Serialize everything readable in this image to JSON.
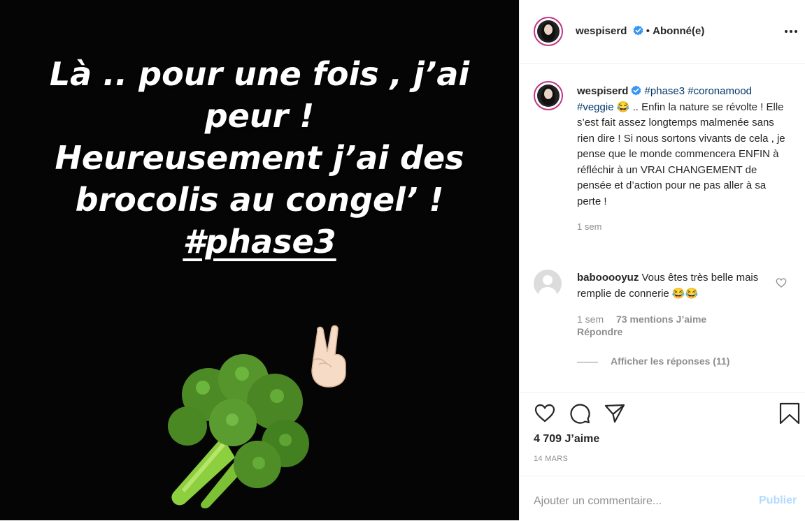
{
  "media": {
    "story_lines": [
      "Là .. pour une fois , j’ai",
      "peur !",
      "Heureusement j’ai des",
      "brocolis au congel’ !"
    ],
    "story_hashtag": "#phase3",
    "emojis": [
      "broccoli-icon",
      "victory-hand-icon"
    ]
  },
  "header": {
    "username": "wespiserd",
    "verified": true,
    "separator": "•",
    "follow_status": "Abonné(e)"
  },
  "caption": {
    "username": "wespiserd",
    "hashtags": [
      "#phase3",
      "#coronamood",
      "#veggie"
    ],
    "emoji": "😂",
    "text": ".. Enfin la nature se révolte ! Elle s’est fait assez longtemps malmenée sans rien dire ! Si nous sortons vivants de cela , je pense que le monde commencera ENFIN à réfléchir à un VRAI CHANGEMENT de pensée et d’action pour ne pas aller à sa perte !",
    "time": "1 sem"
  },
  "comment": {
    "username": "babooooyuz",
    "text": "Vous êtes très belle mais remplie de connerie",
    "emojis": "😂😂",
    "time": "1 sem",
    "likes": "73 mentions J’aime",
    "reply_label": "Répondre",
    "view_replies": "Afficher les réponses (11)"
  },
  "actions": {
    "likes": "4 709 J’aime",
    "date": "14 MARS"
  },
  "comment_box": {
    "placeholder": "Ajouter un commentaire...",
    "post_label": "Publier"
  },
  "colors": {
    "accent_blue": "#0095f6",
    "disabled_blue": "#b3dbff",
    "hashtag": "#00376b",
    "muted": "#8e8e8e"
  }
}
